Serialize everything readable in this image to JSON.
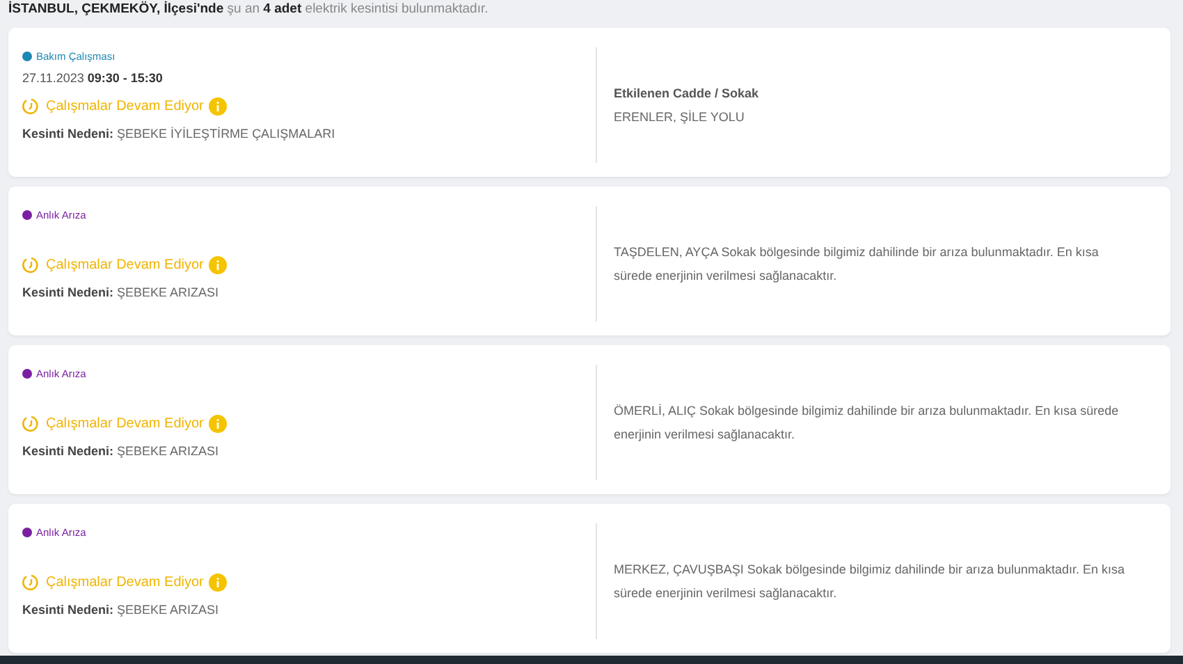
{
  "summary": "**İSTANBUL, ÇEKMEKÖY, İlçesi'nde** şu an **4 adet** elektrik kesintisi bulunmaktadır.",
  "outages": [
    {
      "type": "Bakım Çalışması",
      "color": "#1e88b4",
      "date": "27.11.2023 **09:30 - 15:30**",
      "status": "Çalışmalar Devam Ediyor",
      "reason_label": "Kesinti Nedeni:",
      "reason": "ŞEBEKE İYİLEŞTİRME ÇALIŞMALARI",
      "streets_heading": "Etkilenen Cadde / Sokak",
      "streets": "ERENLER, ŞİLE YOLU"
    },
    {
      "type": "Anlık Arıza",
      "color": "#7b1fa2",
      "status": "Çalışmalar Devam Ediyor",
      "reason_label": "Kesinti Nedeni:",
      "reason": "ŞEBEKE ARIZASI",
      "streets": "TAŞDELEN, AYÇA Sokak bölgesinde bilgimiz dahilinde bir arıza bulunmaktadır. En kısa sürede enerjinin verilmesi sağlanacaktır."
    },
    {
      "type": "Anlık Arıza",
      "color": "#7b1fa2",
      "status": "Çalışmalar Devam Ediyor",
      "reason_label": "Kesinti Nedeni:",
      "reason": "ŞEBEKE ARIZASI",
      "streets": "ÖMERLİ, ALIÇ Sokak bölgesinde bilgimiz dahilinde bir arıza bulunmaktadır. En kısa sürede enerjinin verilmesi sağlanacaktır."
    },
    {
      "type": "Anlık Arıza",
      "color": "#7b1fa2",
      "status": "Çalışmalar Devam Ediyor",
      "reason_label": "Kesinti Nedeni:",
      "reason": "ŞEBEKE ARIZASI",
      "streets": "MERKEZ, ÇAVUŞBAŞI Sokak bölgesinde bilgimiz dahilinde bir arıza bulunmaktadır. En kısa sürede enerjinin verilmesi sağlanacaktır."
    }
  ]
}
